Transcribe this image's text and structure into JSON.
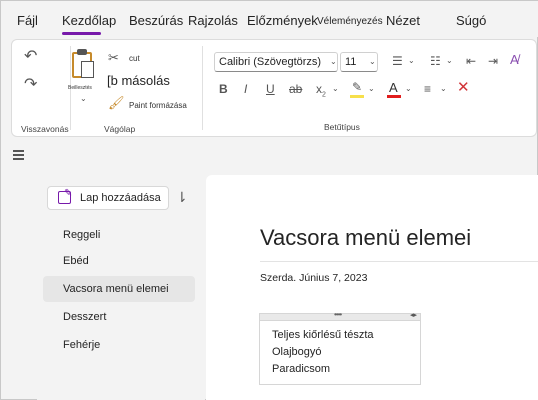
{
  "menu": {
    "items": [
      "Fájl",
      "Kezdőlap",
      "Beszúrás",
      "Rajzolás",
      "Előzmények",
      "Véleményezés",
      "Nézet",
      "Súgó"
    ],
    "active": "Kezdőlap",
    "accent": "#7719aa"
  },
  "ribbon": {
    "undo_group_label": "Visszavonás",
    "clipboard": {
      "paste_label": "Beillesztés",
      "cut_label": "cut",
      "copy_label": "[b másolás",
      "format_painter_label": "Paint formázása",
      "group_label": "Vágólap"
    },
    "font": {
      "family": "Calibri (Szövegtörzs)",
      "size": "11",
      "group_label": "Betűtípus",
      "highlight_color": "#f7e04b",
      "font_color": "#e11d1d"
    },
    "icons": [
      "undo-icon",
      "redo-icon",
      "paste-icon",
      "cut-icon",
      "copy-icon",
      "format-painter-icon",
      "bold-icon",
      "italic-icon",
      "underline-icon",
      "strikethrough-icon",
      "subscript-icon",
      "bullets-icon",
      "numbering-icon",
      "decrease-indent-icon",
      "increase-indent-icon",
      "clear-formatting-icon",
      "highlight-icon",
      "font-color-icon",
      "align-icon",
      "delete-icon"
    ]
  },
  "pages_pane": {
    "add_page_label": "Lap hozzáadása",
    "pages": [
      "Reggeli",
      "Ebéd",
      "Vacsora menü elemei",
      "Desszert",
      "Fehérje"
    ],
    "selected_index": 2
  },
  "page": {
    "title": "Vacsora menü elemei",
    "date": "Szerda. Június 7, 2023",
    "note_lines": [
      "Teljes kiőrlésű tészta",
      "Olajbogyó",
      "Paradicsom"
    ]
  }
}
